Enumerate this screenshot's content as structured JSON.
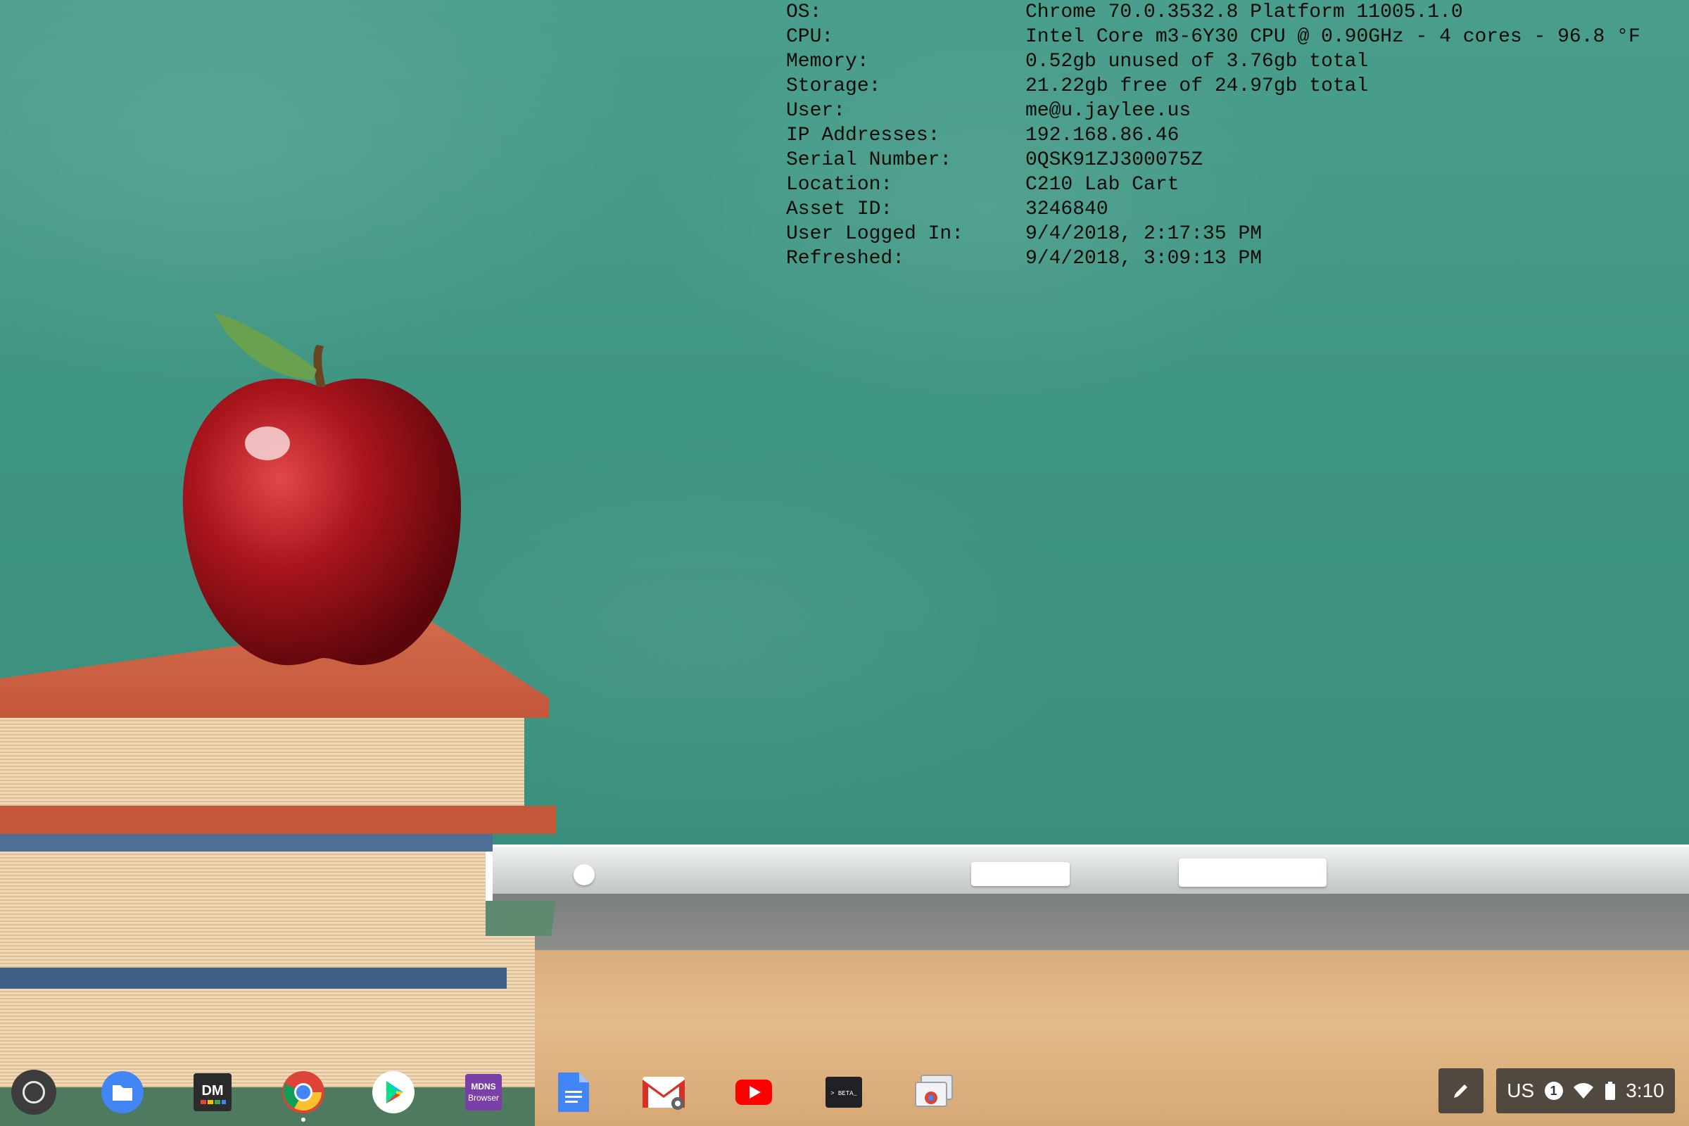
{
  "system_info": {
    "rows": [
      {
        "label": "OS:",
        "value": "Chrome 70.0.3532.8 Platform 11005.1.0"
      },
      {
        "label": "CPU:",
        "value": "Intel Core m3-6Y30 CPU @ 0.90GHz - 4 cores - 96.8 °F"
      },
      {
        "label": "Memory:",
        "value": "0.52gb unused of 3.76gb total"
      },
      {
        "label": "Storage:",
        "value": "21.22gb free of 24.97gb total"
      },
      {
        "label": "User:",
        "value": "me@u.jaylee.us"
      },
      {
        "label": "IP Addresses:",
        "value": "192.168.86.46"
      },
      {
        "label": "Serial Number:",
        "value": "0QSK91ZJ300075Z"
      },
      {
        "label": "Location:",
        "value": "C210 Lab Cart"
      },
      {
        "label": "Asset ID:",
        "value": "3246840"
      },
      {
        "label": "User Logged In:",
        "value": "9/4/2018, 2:17:35 PM"
      },
      {
        "label": "Refreshed:",
        "value": "9/4/2018, 3:09:13 PM"
      }
    ]
  },
  "shelf": {
    "apps": [
      {
        "name": "files-icon"
      },
      {
        "name": "device-manager-icon",
        "label": "DM"
      },
      {
        "name": "chrome-icon"
      },
      {
        "name": "play-store-icon"
      },
      {
        "name": "mdns-browser-icon",
        "label_line1": "MDNS",
        "label_line2": "Browser"
      },
      {
        "name": "docs-icon"
      },
      {
        "name": "gmail-icon"
      },
      {
        "name": "youtube-icon"
      },
      {
        "name": "terminal-icon",
        "label": "> BETA_"
      },
      {
        "name": "screen-share-icon"
      }
    ],
    "status": {
      "ime": "US",
      "notification_count": "1",
      "time": "3:10"
    }
  },
  "colors": {
    "chalkboard": "#3f9682",
    "shelf_bg": "#323232"
  }
}
